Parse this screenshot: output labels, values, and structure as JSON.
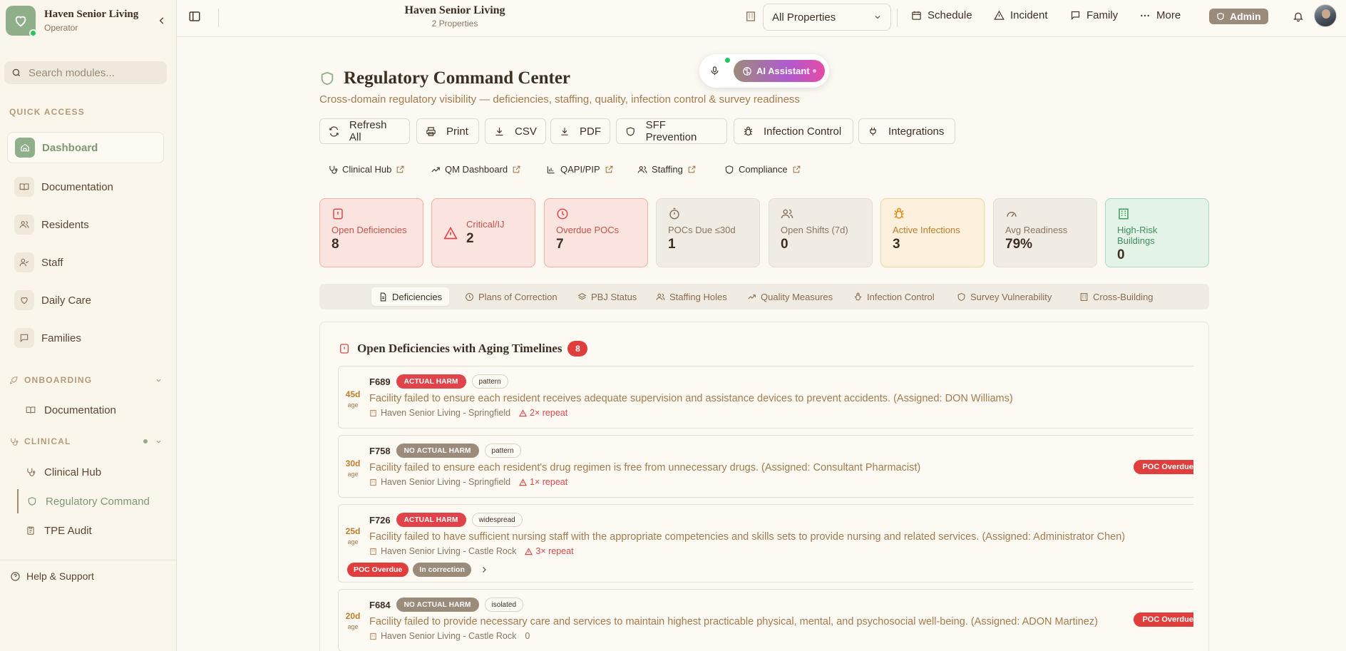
{
  "sidebar": {
    "brand_title": "Haven Senior Living",
    "brand_sub": "Operator",
    "search_placeholder": "Search modules...",
    "quick_access_label": "QUICK ACCESS",
    "quick_items": [
      "Dashboard",
      "Documentation",
      "Residents",
      "Staff",
      "Daily Care",
      "Families"
    ],
    "onboarding_label": "ONBOARDING",
    "onboarding_items": [
      "Documentation"
    ],
    "clinical_label": "CLINICAL",
    "clinical_items": [
      "Clinical Hub",
      "Regulatory Command",
      "TPE Audit"
    ],
    "help_label": "Help & Support"
  },
  "topbar": {
    "title": "Haven Senior Living",
    "subtitle": "2 Properties",
    "property_select": "All Properties",
    "schedule": "Schedule",
    "incident": "Incident",
    "family": "Family",
    "more": "More",
    "admin": "Admin"
  },
  "ai": {
    "label": "AI Assistant"
  },
  "page": {
    "title": "Regulatory Command Center",
    "subtitle": "Cross-domain regulatory visibility — deficiencies, staffing, quality, infection control & survey readiness"
  },
  "actions": [
    "Refresh All",
    "Print",
    "CSV",
    "PDF",
    "SFF Prevention",
    "Infection Control",
    "Integrations"
  ],
  "links": [
    "Clinical Hub",
    "QM Dashboard",
    "QAPI/PIP",
    "Staffing",
    "Compliance"
  ],
  "kpis": [
    {
      "label": "Open Deficiencies",
      "value": "8"
    },
    {
      "label": "Critical/IJ",
      "value": "2"
    },
    {
      "label": "Overdue POCs",
      "value": "7"
    },
    {
      "label": "POCs Due ≤30d",
      "value": "1"
    },
    {
      "label": "Open Shifts (7d)",
      "value": "0"
    },
    {
      "label": "Active Infections",
      "value": "3"
    },
    {
      "label": "Avg Readiness",
      "value": "79%"
    },
    {
      "label": "High-Risk Buildings",
      "value": "0"
    }
  ],
  "tabs": [
    "Deficiencies",
    "Plans of Correction",
    "PBJ Status",
    "Staffing Holes",
    "Quality Measures",
    "Infection Control",
    "Survey Vulnerability",
    "Cross-Building"
  ],
  "panel": {
    "title": "Open Deficiencies with Aging Timelines",
    "count": "8",
    "age_unit": "age",
    "deficiencies": [
      {
        "code": "F689",
        "age": "45d",
        "severity": "ACTUAL HARM",
        "scope": "pattern",
        "desc": "Facility failed to ensure each resident receives adequate supervision and assistance devices to prevent accidents. (Assigned: DON Williams)",
        "location": "Haven Senior Living - Springfield",
        "repeat": "2× repeat"
      },
      {
        "code": "F758",
        "age": "30d",
        "severity": "NO ACTUAL HARM",
        "scope": "pattern",
        "desc": "Facility failed to ensure each resident's drug regimen is free from unnecessary drugs. (Assigned: Consultant Pharmacist)",
        "location": "Haven Senior Living - Springfield",
        "repeat": "1× repeat",
        "poc": "POC Overdue"
      },
      {
        "code": "F726",
        "age": "25d",
        "severity": "ACTUAL HARM",
        "scope": "widespread",
        "desc": "Facility failed to have sufficient nursing staff with the appropriate competencies and skills sets to provide nursing and related services. (Assigned: Administrator Chen)",
        "location": "Haven Senior Living - Castle Rock",
        "repeat": "3× repeat",
        "chip_poc": "POC Overdue",
        "chip_status": "In correction"
      },
      {
        "code": "F684",
        "age": "20d",
        "severity": "NO ACTUAL HARM",
        "scope": "isolated",
        "desc": "Facility failed to provide necessary care and services to maintain highest practicable physical, mental, and psychosocial well-being. (Assigned: ADON Martinez)",
        "location": "Haven Senior Living - Castle Rock",
        "repeat_count": "0",
        "poc": "POC Overdue"
      }
    ]
  },
  "colors": {
    "accent_green": "#8fae8a",
    "danger": "#e03d3d",
    "amber": "#c07b2a",
    "muted": "#9b8b7a"
  }
}
